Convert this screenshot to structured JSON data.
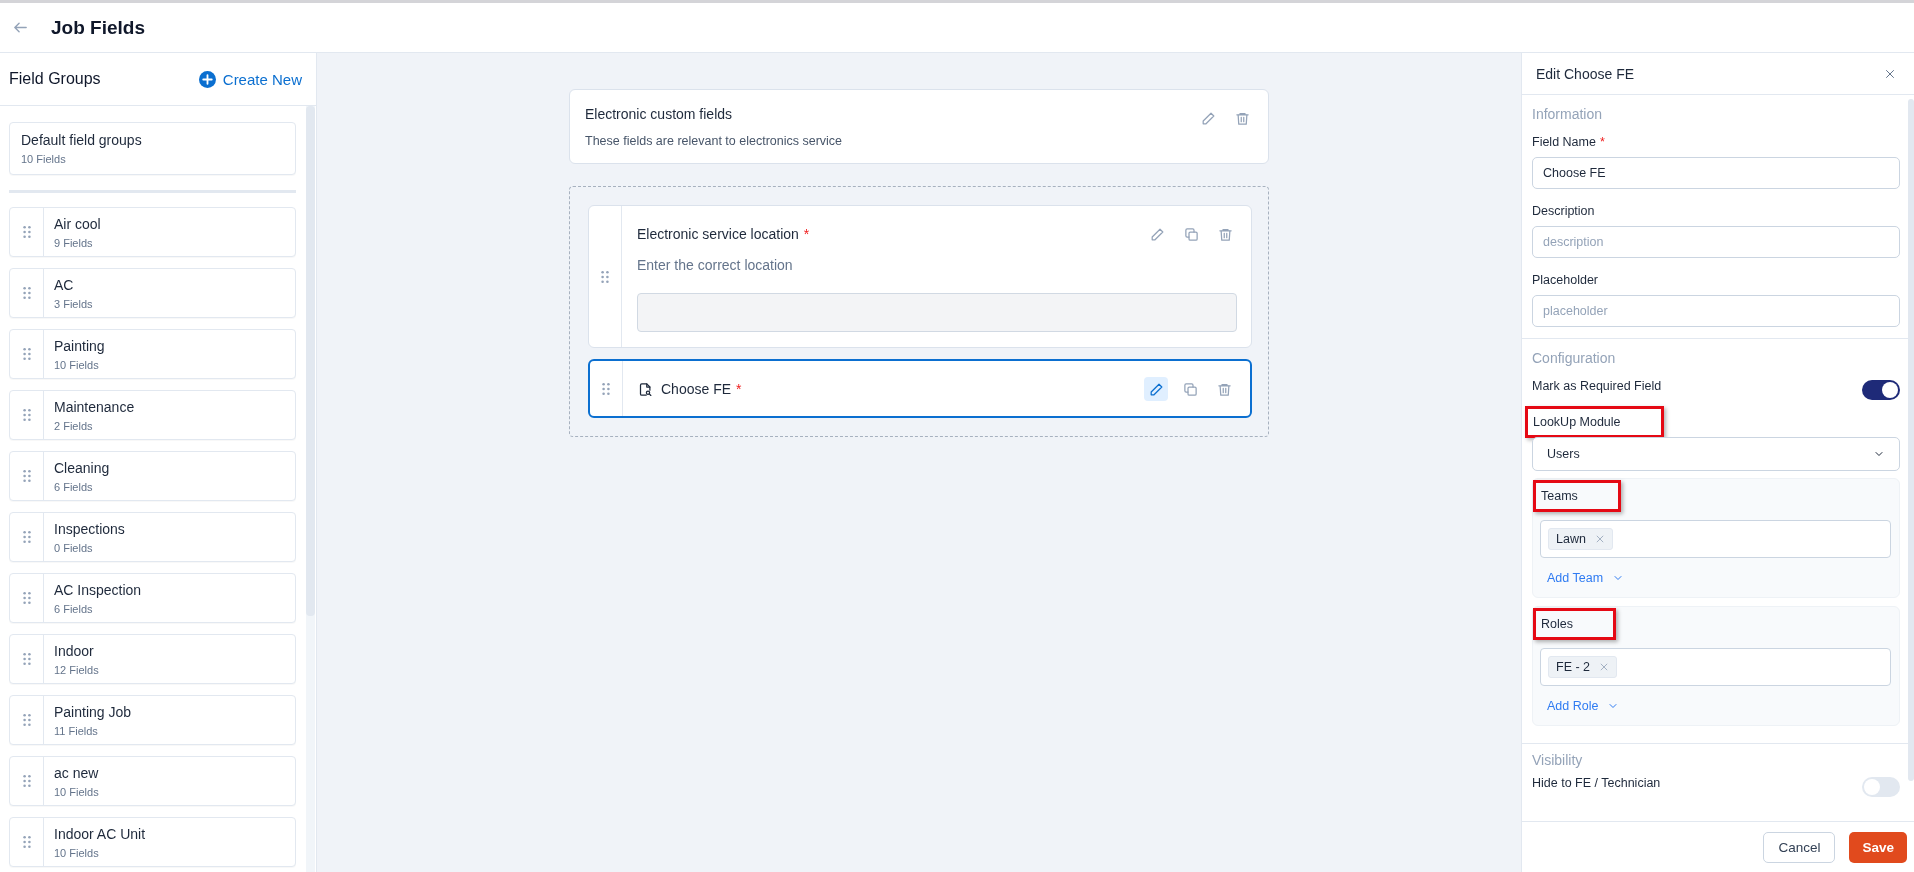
{
  "header": {
    "title": "Job Fields"
  },
  "sidebar": {
    "title": "Field Groups",
    "create_button": "Create New",
    "default_group": {
      "name": "Default field groups",
      "count": "10 Fields"
    },
    "groups": [
      {
        "name": "Air cool",
        "count": "9 Fields"
      },
      {
        "name": "AC",
        "count": "3 Fields"
      },
      {
        "name": "Painting",
        "count": "10 Fields"
      },
      {
        "name": "Maintenance",
        "count": "2 Fields"
      },
      {
        "name": "Cleaning",
        "count": "6 Fields"
      },
      {
        "name": "Inspections",
        "count": "0 Fields"
      },
      {
        "name": "AC Inspection",
        "count": "6 Fields"
      },
      {
        "name": "Indoor",
        "count": "12 Fields"
      },
      {
        "name": "Painting Job",
        "count": "11 Fields"
      },
      {
        "name": "ac new",
        "count": "10 Fields"
      },
      {
        "name": "Indoor AC Unit",
        "count": "10 Fields"
      }
    ]
  },
  "canvas": {
    "section": {
      "title": "Electronic custom fields",
      "description": "These fields are relevant to electronics service"
    },
    "fields": [
      {
        "kind": "text",
        "label": "Electronic service location",
        "required_mark": "*",
        "description": "Enter the correct location",
        "selected": false
      },
      {
        "kind": "lookup",
        "label": "Choose FE",
        "required_mark": "*",
        "selected": true
      }
    ]
  },
  "panel": {
    "title": "Edit Choose FE",
    "information": {
      "heading": "Information",
      "field_name": {
        "label": "Field Name",
        "required_mark": "*",
        "value": "Choose FE"
      },
      "description": {
        "label": "Description",
        "placeholder": "description"
      },
      "placeholder": {
        "label": "Placeholder",
        "placeholder": "placeholder"
      }
    },
    "configuration": {
      "heading": "Configuration",
      "required_toggle": {
        "label": "Mark as Required Field",
        "on": true
      },
      "lookup_module": {
        "label": "LookUp Module",
        "value": "Users",
        "highlighted": true
      },
      "teams": {
        "label": "Teams",
        "highlighted": true,
        "tags": [
          "Lawn"
        ],
        "add": "Add Team"
      },
      "roles": {
        "label": "Roles",
        "highlighted": true,
        "tags": [
          "FE - 2"
        ],
        "add": "Add Role"
      }
    },
    "visibility": {
      "heading": "Visibility",
      "toggle": {
        "label": "Hide to FE / Technician",
        "on": false
      }
    },
    "buttons": {
      "cancel": "Cancel",
      "save": "Save"
    }
  }
}
